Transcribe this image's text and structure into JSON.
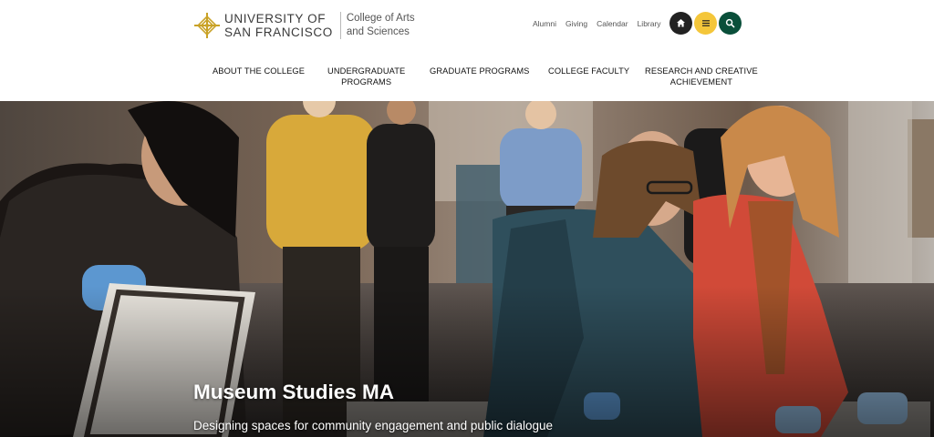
{
  "brand": {
    "university_line1": "UNIVERSITY OF",
    "university_line2": "SAN FRANCISCO",
    "college_line1": "College of Arts",
    "college_line2": "and Sciences",
    "accent_color": "#c9a227"
  },
  "utility_links": [
    "Alumni",
    "Giving",
    "Calendar",
    "Library"
  ],
  "icon_buttons": [
    {
      "name": "home-icon",
      "color": "#222222"
    },
    {
      "name": "menu-icon",
      "color": "#f4c63a"
    },
    {
      "name": "search-icon",
      "color": "#0a4f3a"
    }
  ],
  "nav": [
    {
      "line1": "ABOUT THE COLLEGE",
      "line2": ""
    },
    {
      "line1": "UNDERGRADUATE",
      "line2": "PROGRAMS"
    },
    {
      "line1": "GRADUATE PROGRAMS",
      "line2": ""
    },
    {
      "line1": "COLLEGE FACULTY",
      "line2": ""
    },
    {
      "line1": "RESEARCH AND CREATIVE",
      "line2": "ACHIEVEMENT"
    }
  ],
  "hero": {
    "title": "Museum Studies MA",
    "subtitle": "Designing spaces for community engagement and public dialogue"
  }
}
